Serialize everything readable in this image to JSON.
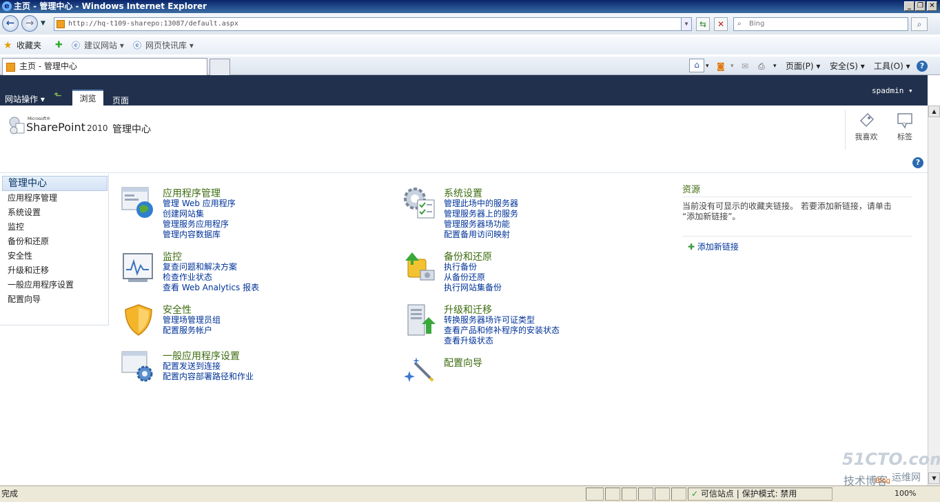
{
  "window": {
    "title": "主页 - 管理中心 - Windows Internet Explorer",
    "minimize": "_",
    "restore": "❐",
    "close": "✕"
  },
  "address": {
    "url": "http://hq-t109-sharepo:13087/default.aspx",
    "search_placeholder": "Bing"
  },
  "favorites": {
    "label": "收藏夹",
    "items": [
      "建议网站 ▾",
      "网页快讯库 ▾"
    ]
  },
  "tab": {
    "title": "主页 - 管理中心"
  },
  "commandbar": {
    "page": "页面(P) ▾",
    "safety": "安全(S) ▾",
    "tools": "工具(O) ▾"
  },
  "ribbon": {
    "site_actions": "网站操作 ▾",
    "tab_browse": "浏览",
    "tab_page": "页面",
    "user": "spadmin ▾"
  },
  "header": {
    "logo_microsoft": "Microsoft®",
    "logo_sharepoint": "SharePoint",
    "logo_version": "2010",
    "site_title": "管理中心",
    "like": "我喜欢",
    "tags": "标签"
  },
  "leftnav": {
    "selected": "管理中心",
    "items": [
      "应用程序管理",
      "系统设置",
      "监控",
      "备份和还原",
      "安全性",
      "升级和迁移",
      "一般应用程序设置",
      "配置向导"
    ]
  },
  "groups": {
    "app_mgmt": {
      "title": "应用程序管理",
      "links": [
        "管理 Web 应用程序",
        "创建网站集",
        "管理服务应用程序",
        "管理内容数据库"
      ]
    },
    "monitoring": {
      "title": "监控",
      "links": [
        "复查问题和解决方案",
        "检查作业状态",
        "查看 Web Analytics 报表"
      ]
    },
    "security": {
      "title": "安全性",
      "links": [
        "管理场管理员组",
        "配置服务帐户"
      ]
    },
    "general": {
      "title": "一般应用程序设置",
      "links": [
        "配置发送到连接",
        "配置内容部署路径和作业"
      ]
    },
    "system": {
      "title": "系统设置",
      "links": [
        "管理此场中的服务器",
        "管理服务器上的服务",
        "管理服务器场功能",
        "配置备用访问映射"
      ]
    },
    "backup": {
      "title": "备份和还原",
      "links": [
        "执行备份",
        "从备份还原",
        "执行网站集备份"
      ]
    },
    "upgrade": {
      "title": "升级和迁移",
      "links": [
        "转换服务器场许可证类型",
        "查看产品和修补程序的安装状态",
        "查看升级状态"
      ]
    },
    "wizard": {
      "title": "配置向导"
    }
  },
  "resources": {
    "title": "资源",
    "text1": "当前没有可显示的收藏夹链接。 若要添加新链接，请单击",
    "text2": "“添加新链接”。",
    "add_link": "添加新链接"
  },
  "status": {
    "left": "完成",
    "zone": "可信站点 | 保护模式: 禁用",
    "zoom": "100%"
  },
  "watermark": {
    "brand": "51CTO.com",
    "sub": "技术博客",
    "sub2": "运维网",
    "blog": "Blog"
  }
}
